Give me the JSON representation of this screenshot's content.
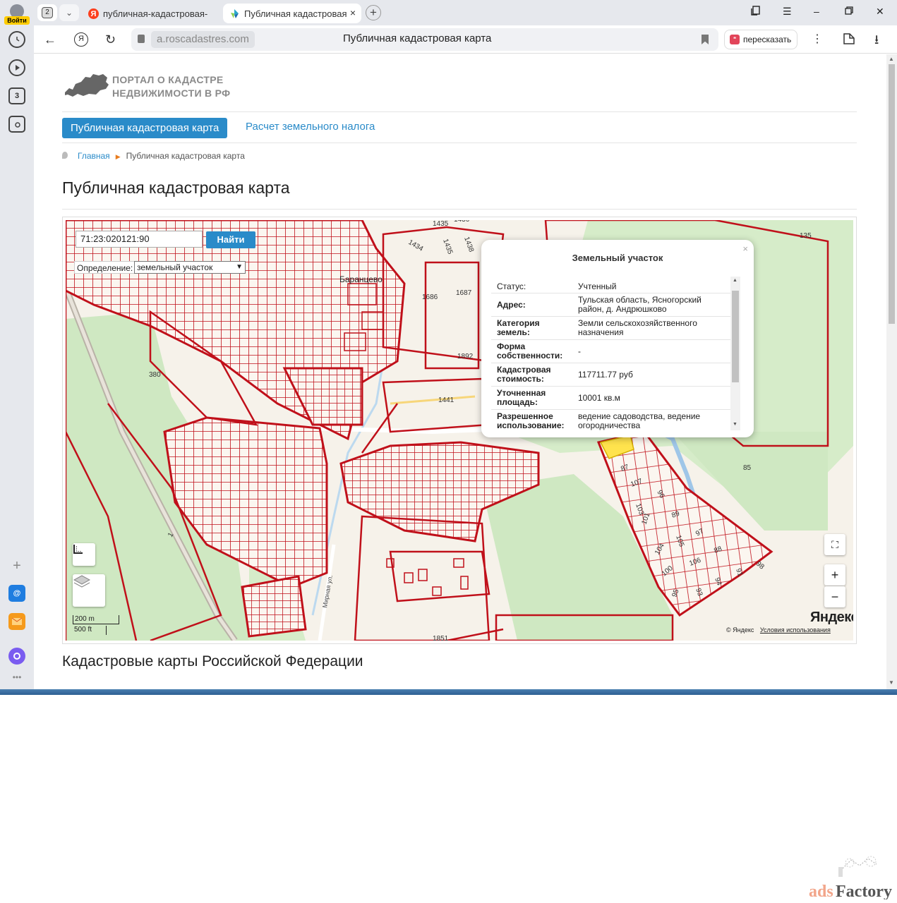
{
  "browser": {
    "login_label": "Войти",
    "tab_count": "2",
    "tabs": [
      {
        "title": "публичная-кадастровая-",
        "favicon": "Я"
      },
      {
        "title": "Публичная кадастровая",
        "close": "×"
      }
    ],
    "new_tab": "+",
    "url": "a.roscadastres.com",
    "page_title": "Публичная кадастровая карта",
    "retell_label": "пересказать",
    "sidebar_badge": "3"
  },
  "site": {
    "logo_line1": "ПОРТАЛ О КАДАСТРЕ",
    "logo_line2": "НЕДВИЖИМОСТИ В РФ",
    "nav": {
      "active": "Публичная кадастровая карта",
      "tax": "Расчет земельного налога"
    },
    "breadcrumb": {
      "home": "Главная",
      "current": "Публичная кадастровая карта"
    },
    "heading": "Публичная кадастровая карта",
    "section_heading": "Кадастровые карты Российской Федерации"
  },
  "map": {
    "search_value": "71:23:020121:90",
    "find_button": "Найти",
    "definition_label": "Определение:",
    "definition_value": "земельный участок",
    "village_label": "Баранцево",
    "street_label": "Мирная ул.",
    "parcel_numbers": [
      "1435",
      "1434",
      "1435",
      "1436",
      "1438",
      "135",
      "1686",
      "1687",
      "1892",
      "1441",
      "380",
      "85",
      "87",
      "107",
      "103",
      "96",
      "89",
      "101",
      "105",
      "97",
      "104",
      "106",
      "88",
      "100",
      "93",
      "94",
      "91",
      "98",
      "95",
      "1",
      "1851"
    ],
    "scale_metric": "200 m",
    "scale_imperial": "500 ft",
    "brand": "Яндекс",
    "copyright": "© Яндекс",
    "terms": "Условия использования",
    "zoom_in": "+",
    "zoom_out": "−"
  },
  "popup": {
    "title": "Земельный участок",
    "close": "×",
    "rows": [
      {
        "key": "Статус:",
        "value": "Учтенный"
      },
      {
        "key": "Адрес:",
        "value": "Тульская область, Ясногорский район, д. Андрюшково"
      },
      {
        "key": "Категория земель:",
        "value": "Земли сельскохозяйственного назначения"
      },
      {
        "key": "Форма собственности:",
        "value": "-"
      },
      {
        "key": "Кадастровая стоимость:",
        "value": "117711.77 руб"
      },
      {
        "key": "Уточненная площадь:",
        "value": "10001 кв.м"
      },
      {
        "key": "Разрешенное использование:",
        "value": "ведение садоводства, ведение огородничества"
      }
    ]
  },
  "watermark": "adsFactory",
  "colors": {
    "accent": "#2a8bc9",
    "parcel_border": "#c0101a",
    "forest": "#cfe8c2",
    "map_bg": "#f6f2ea",
    "highlight": "#ffe34d"
  }
}
